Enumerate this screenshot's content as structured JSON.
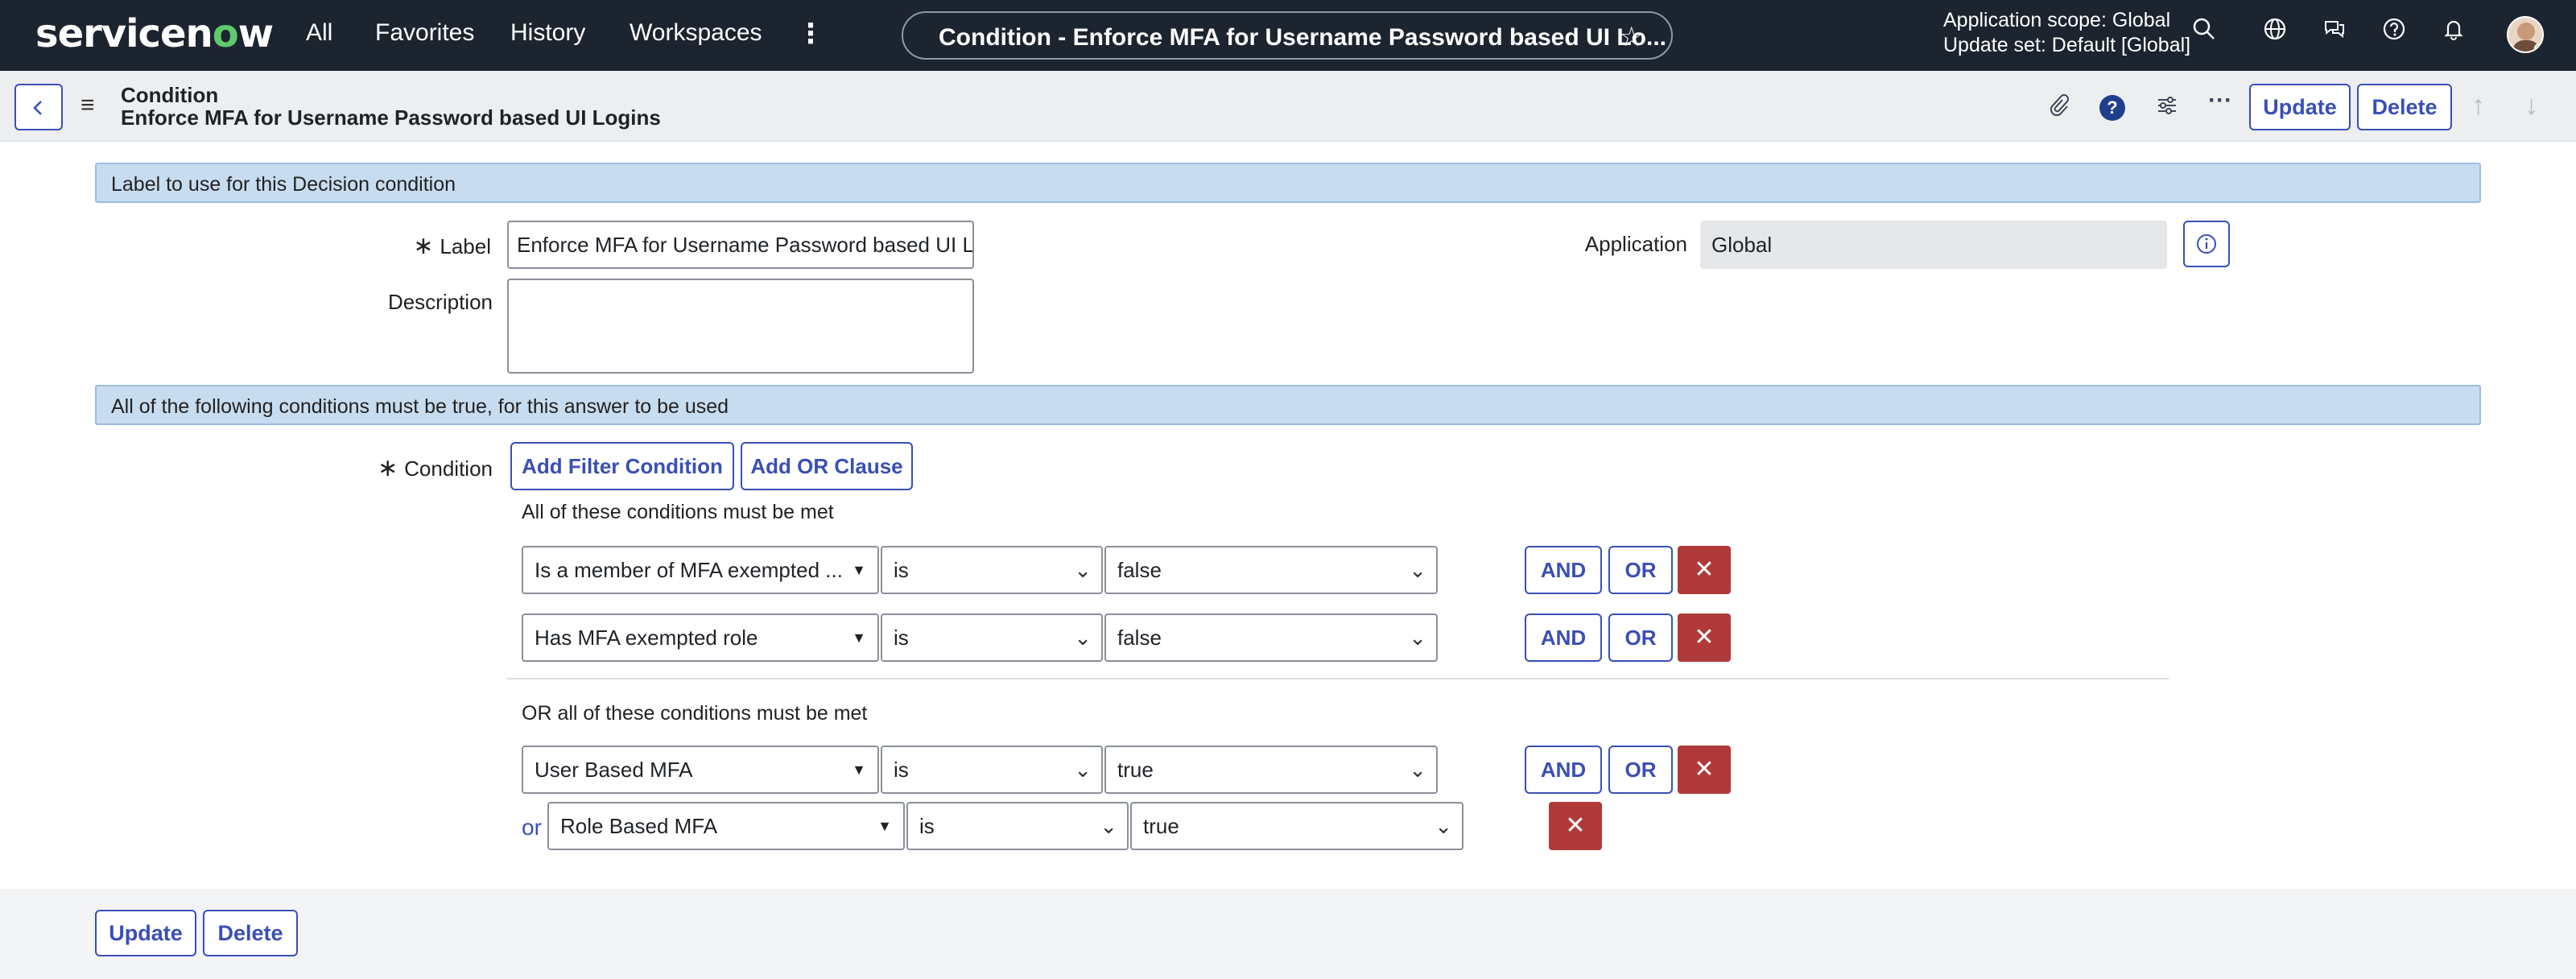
{
  "topbar": {
    "logo_pre": "servicen",
    "logo_o": "o",
    "logo_post": "w",
    "nav": [
      "All",
      "Favorites",
      "History",
      "Workspaces"
    ],
    "more": "⋮",
    "record_title": "Condition - Enforce MFA for Username Password based UI Lo...",
    "star": "☆",
    "scope_line1": "Application scope: Global",
    "scope_line2": "Update set: Default [Global]"
  },
  "header": {
    "line1": "Condition",
    "line2": "Enforce MFA for Username Password based UI Logins",
    "update_label": "Update",
    "delete_label": "Delete"
  },
  "section1": "Label to use for this Decision condition",
  "form": {
    "label_label": "Label",
    "label_value": "Enforce MFA for Username Password based UI Logins",
    "description_label": "Description",
    "description_value": "",
    "application_label": "Application",
    "application_value": "Global"
  },
  "section2": "All of the following conditions must be true, for this answer to be used",
  "condition": {
    "label": "Condition",
    "add_filter": "Add Filter Condition",
    "add_or": "Add OR Clause",
    "group1_caption": "All of these conditions must be met",
    "group2_caption": "OR all of these conditions must be met",
    "and_label": "AND",
    "or_label": "OR",
    "or_prefix": "or",
    "rows": [
      {
        "field": "Is a member of MFA exempted ...",
        "op": "is",
        "value": "false"
      },
      {
        "field": "Has MFA exempted role",
        "op": "is",
        "value": "false"
      },
      {
        "field": "User Based MFA",
        "op": "is",
        "value": "true"
      },
      {
        "field": "Role Based MFA",
        "op": "is",
        "value": "true"
      }
    ]
  },
  "footer": {
    "update_label": "Update",
    "delete_label": "Delete"
  }
}
